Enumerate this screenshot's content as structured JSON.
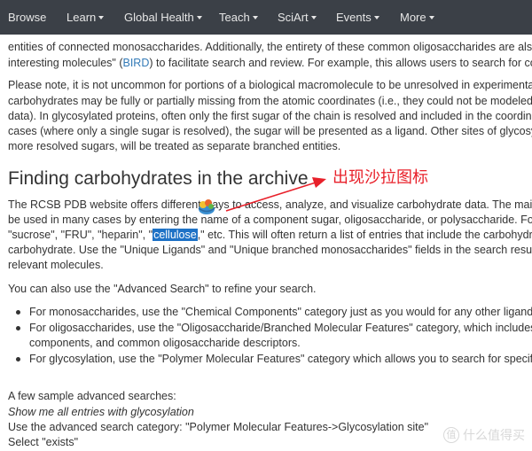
{
  "nav": {
    "items": [
      {
        "label": "Browse",
        "dropdown": false
      },
      {
        "label": "Learn",
        "dropdown": true
      },
      {
        "label": "Global Health",
        "dropdown": true
      },
      {
        "label": "Teach",
        "dropdown": true
      },
      {
        "label": "SciArt",
        "dropdown": true
      },
      {
        "label": "Events",
        "dropdown": true
      },
      {
        "label": "More",
        "dropdown": true
      }
    ],
    "bg_color": "#3b4047"
  },
  "intro": {
    "line1": "entities of connected monosaccharides. Additionally, the entirety of these common oligosaccharides are also rep",
    "line2_pre": "interesting molecules\" (",
    "line2_link": "BIRD",
    "line2_post": ") to facilitate search and review. For example, this allows users to search for comm"
  },
  "note": {
    "lines": [
      "Please note, it is not uncommon for portions of a biological macromolecule to be unresolved in experimental dat",
      "carbohydrates may be fully or partially missing from the atomic coordinates (i.e., they could not be modeled from",
      "data). In glycosylated proteins, often only the first sugar of the chain is resolved and included in the coordinates",
      "cases (where only a single sugar is resolved), the sugar will be presented as a ligand. Other sites of glycosylatio",
      "more resolved sugars, will be treated as separate branched entities."
    ]
  },
  "section": {
    "heading": "Finding carbohydrates in the archive",
    "p1_line1": "The RCSB PDB website offers different ways to access, analyze, and visualize carbohydrate data. The main se",
    "p1_line2": "be used in many cases by entering the name of a component sugar, oligosaccharide, or polysaccharide. For exa",
    "p1_line3_pre": "\"sucrose\", \"FRU\", \"heparin\", \"",
    "p1_line3_hl": "cellulose",
    "p1_line3_post": ",\" etc. This will often return a list of entries that include the carbohydrate a",
    "p1_line4": "carbohydrate. Use the \"Unique Ligands\" and \"Unique branched monosaccharides\" fields in the search result lis",
    "p1_line5": "relevant molecules.",
    "p2": "You can also use the \"Advanced Search\" to refine your search."
  },
  "bullets": [
    {
      "line1": "For monosaccharides, use the \"Chemical Components\" category just as you would for any other ligand."
    },
    {
      "line1": "For oligosaccharides, use the \"Oligosaccharide/Branched Molecular Features\" category, which includes c",
      "line2": "components, and common oligosaccharide descriptors."
    },
    {
      "line1": "For glycosylation, use the \"Polymer Molecular Features\" category which allows you to search for specific"
    }
  ],
  "samples": {
    "heading": "A few sample advanced searches:",
    "example_title": "Show me all entries with glycosylation",
    "step1": "Use the advanced search category: \"Polymer Molecular Features->Glycosylation site\"",
    "step2": "Select \"exists\""
  },
  "annotation": {
    "text": "出现沙拉图标",
    "color": "#e8202a"
  },
  "watermark": {
    "logo_glyph": "值",
    "text": "什么值得买"
  }
}
